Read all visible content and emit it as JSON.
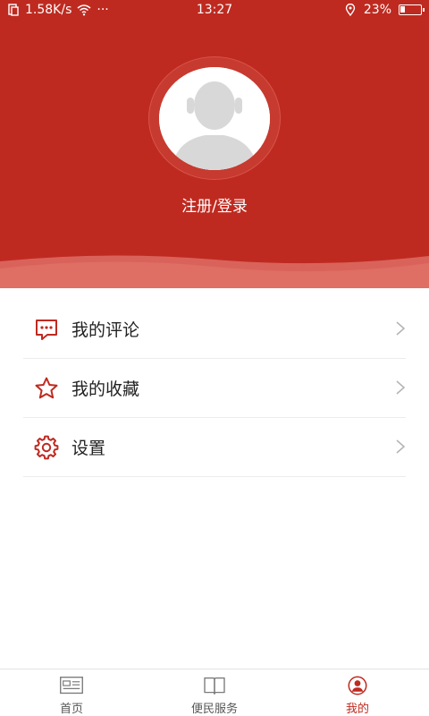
{
  "status_bar": {
    "speed": "1.58K/s",
    "more": "···",
    "time": "13:27",
    "battery_text": "23%",
    "battery_level": 0.23
  },
  "profile": {
    "login_label": "注册/登录"
  },
  "menu": {
    "items": [
      {
        "label": "我的评论",
        "icon": "comment-icon"
      },
      {
        "label": "我的收藏",
        "icon": "star-icon"
      },
      {
        "label": "设置",
        "icon": "gear-icon"
      }
    ]
  },
  "tabs": [
    {
      "label": "首页",
      "icon": "newspaper-icon",
      "active": false
    },
    {
      "label": "便民服务",
      "icon": "book-icon",
      "active": false
    },
    {
      "label": "我的",
      "icon": "user-circle-icon",
      "active": true
    }
  ],
  "colors": {
    "brand": "#bf2a20",
    "text": "#222222",
    "divider": "#ececec"
  }
}
